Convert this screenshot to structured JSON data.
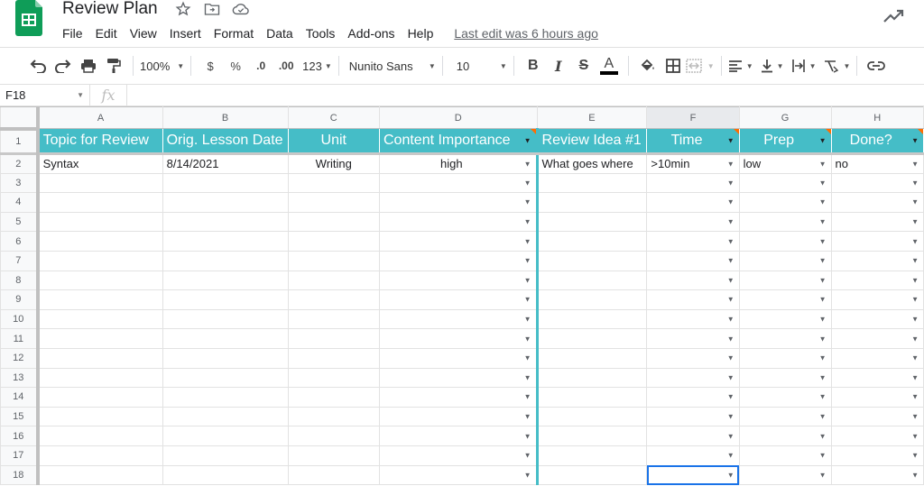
{
  "app": {
    "title": "Review Plan",
    "last_edit": "Last edit was 6 hours ago",
    "menu": [
      "File",
      "Edit",
      "View",
      "Insert",
      "Format",
      "Data",
      "Tools",
      "Add-ons",
      "Help"
    ]
  },
  "toolbar": {
    "zoom": "100%",
    "currency": "$",
    "percent": "%",
    "dec_decrease": ".0",
    "dec_increase": ".00",
    "more_formats": "123",
    "font": "Nunito Sans",
    "font_size": "10",
    "bold": "B",
    "italic": "I",
    "strike": "S",
    "text_color": "A"
  },
  "formula_bar": {
    "cell_ref": "F18",
    "fx": "fx"
  },
  "colors": {
    "header_teal": "#45bdc7",
    "note_marker": "#ff6d01",
    "selection": "#1a73e8"
  },
  "sheet": {
    "columns": [
      "A",
      "B",
      "C",
      "D",
      "E",
      "F",
      "G",
      "H"
    ],
    "headers": [
      "Topic for Review",
      "Orig. Lesson Date",
      "Unit",
      "Content Importance",
      "Review Idea #1",
      "Time",
      "Prep",
      "Done?"
    ],
    "row_numbers": [
      "1",
      "2",
      "3",
      "4",
      "5",
      "6",
      "7",
      "8",
      "9",
      "10",
      "11",
      "12",
      "13",
      "14",
      "15",
      "16",
      "17",
      "18"
    ],
    "rows": [
      [
        "Syntax",
        "8/14/2021",
        "Writing",
        "high",
        "What goes where",
        ">10min",
        "low",
        "no"
      ]
    ]
  }
}
